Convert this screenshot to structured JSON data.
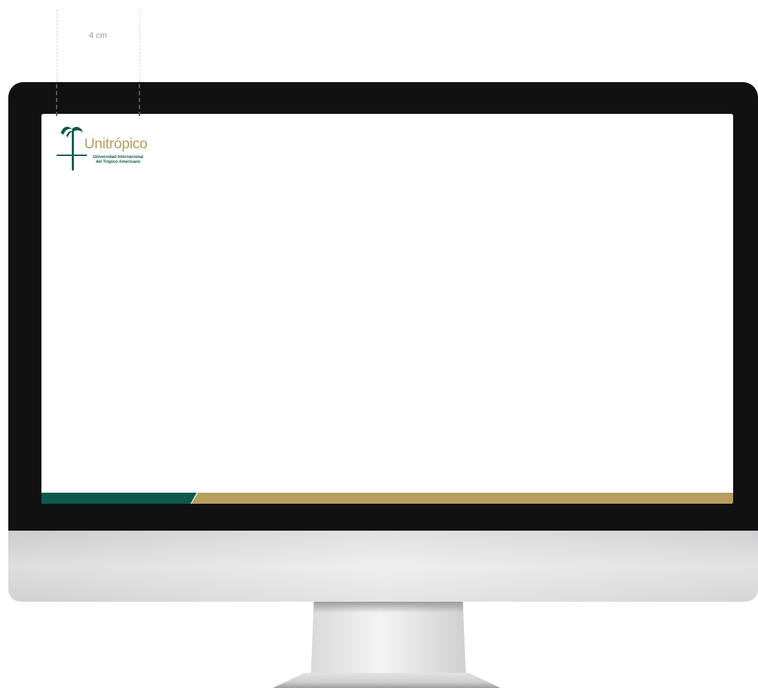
{
  "guide": {
    "label": "4 cm"
  },
  "logo": {
    "name": "Unitrópico",
    "subtitle_line1": "Universidad Internacional",
    "subtitle_line2": "del Trópico Americano"
  },
  "colors": {
    "brand_green": "#0d5a4d",
    "brand_gold": "#b79d5f",
    "bezel": "#111111"
  }
}
